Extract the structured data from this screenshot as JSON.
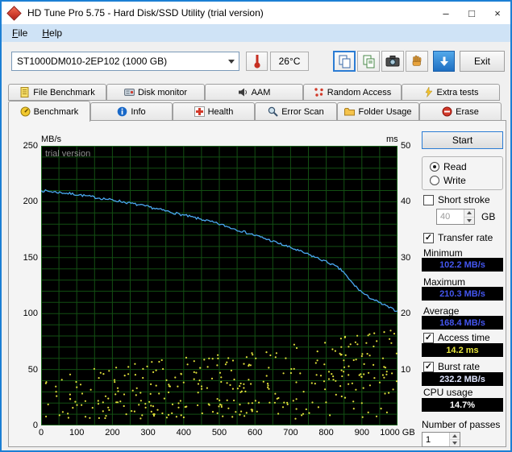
{
  "window": {
    "title": "HD Tune Pro 5.75 - Hard Disk/SSD Utility (trial version)",
    "controls": {
      "minimize": "–",
      "maximize": "□",
      "close": "×"
    }
  },
  "menu": {
    "items": [
      "File",
      "Help"
    ]
  },
  "toolbar": {
    "drive_select_value": "ST1000DM010-2EP102 (1000 GB)",
    "temperature": "26°C",
    "exit_label": "Exit"
  },
  "icons": {
    "app_icon": "red-diamond",
    "thermometer_icon": "thermometer",
    "copy_screenshot_icon": "overlapping-pages",
    "copy_pages_icon": "overlapping-pages",
    "camera_icon": "camera",
    "hand_icon": "pointing-hand",
    "save_results_icon": "blue-down-arrow",
    "dropdown_arrow": "chevron-down"
  },
  "tabs": {
    "row1": [
      {
        "label": "File Benchmark"
      },
      {
        "label": "Disk monitor"
      },
      {
        "label": "AAM"
      },
      {
        "label": "Random Access"
      },
      {
        "label": "Extra tests"
      }
    ],
    "row2": [
      {
        "label": "Benchmark",
        "selected": true
      },
      {
        "label": "Info",
        "selected": false
      },
      {
        "label": "Health",
        "selected": false
      },
      {
        "label": "Error Scan",
        "selected": false
      },
      {
        "label": "Folder Usage",
        "selected": false
      },
      {
        "label": "Erase",
        "selected": false
      }
    ]
  },
  "watermark": "trial version",
  "glyphs": {
    "check": "✓"
  },
  "colors": {
    "accent": "#1c7fd4",
    "chart_bg": "#000000",
    "grid": "#134f13",
    "grid_border": "#1d661d",
    "transfer_line": "#4aa8f0",
    "access_dots": "#dede3a",
    "stat_value_blue": "#4456f0",
    "access_value_yellow": "#e8e63c",
    "burst_value": "#dfe5ff",
    "cpu_value": "#ffffff"
  },
  "controls": {
    "start": "Start",
    "read": "Read",
    "write": "Write",
    "short_stroke": "Short stroke",
    "short_stroke_value": "40",
    "capacity_unit": "GB",
    "transfer_rate": "Transfer rate",
    "minimum": "Minimum",
    "maximum": "Maximum",
    "average": "Average",
    "access_time": "Access time",
    "burst_rate": "Burst rate",
    "cpu_usage": "CPU usage",
    "number_of_passes": "Number of passes",
    "passes_value": "1"
  },
  "results": {
    "minimum": "102.2 MB/s",
    "maximum": "210.3 MB/s",
    "average": "168.4 MB/s",
    "access_time": "14.2 ms",
    "burst_rate": "232.2 MB/s",
    "cpu_usage": "14.7%"
  },
  "chart_data": {
    "type": "line+scatter",
    "title": "",
    "x_axis": {
      "min": 0,
      "max": 1000,
      "unit": "GB",
      "grid_step_gb": 50,
      "tick_labels": [
        "0",
        "100",
        "200",
        "300",
        "400",
        "500",
        "600",
        "700",
        "800",
        "900",
        "1000 GB"
      ]
    },
    "left_axis": {
      "label": "MB/s",
      "min": 0,
      "max": 250,
      "grid_step": 10,
      "ticks": [
        "250",
        "200",
        "150",
        "100",
        "50",
        "0"
      ]
    },
    "right_axis": {
      "label": "ms",
      "min": 0,
      "max": 50,
      "ticks": [
        "50",
        "40",
        "30",
        "20",
        "10"
      ]
    },
    "series": [
      {
        "name": "Transfer rate",
        "type": "line",
        "axis": "left",
        "unit": "MB/s",
        "anchors_gb_mbs": [
          [
            0,
            210
          ],
          [
            30,
            209
          ],
          [
            60,
            208
          ],
          [
            100,
            206.5
          ],
          [
            140,
            204.5
          ],
          [
            180,
            202.5
          ],
          [
            220,
            200.5
          ],
          [
            260,
            198
          ],
          [
            300,
            195.5
          ],
          [
            340,
            192.5
          ],
          [
            380,
            189.5
          ],
          [
            420,
            186.5
          ],
          [
            460,
            183.5
          ],
          [
            500,
            180
          ],
          [
            540,
            176
          ],
          [
            580,
            172
          ],
          [
            620,
            168
          ],
          [
            660,
            163.5
          ],
          [
            700,
            159
          ],
          [
            740,
            154
          ],
          [
            780,
            149
          ],
          [
            810,
            145
          ],
          [
            830,
            141.5
          ],
          [
            850,
            137
          ],
          [
            862,
            131
          ],
          [
            870,
            128.5
          ],
          [
            880,
            125
          ],
          [
            895,
            120.5
          ],
          [
            910,
            116.5
          ],
          [
            930,
            113
          ],
          [
            950,
            109.5
          ],
          [
            970,
            106.5
          ],
          [
            985,
            104
          ],
          [
            1000,
            102.3
          ]
        ],
        "noise_amp": 1.1,
        "sample_step_gb": 4,
        "seed": 7
      },
      {
        "name": "Access time",
        "type": "scatter",
        "axis": "right",
        "unit": "ms",
        "count": 340,
        "seed": 20,
        "x_bias_pow": 0.8,
        "y_min_ms": 1.2,
        "y_env_base_ms": 7.8,
        "y_env_growth_ms": 8.2,
        "y_pow": 1.05
      }
    ]
  }
}
